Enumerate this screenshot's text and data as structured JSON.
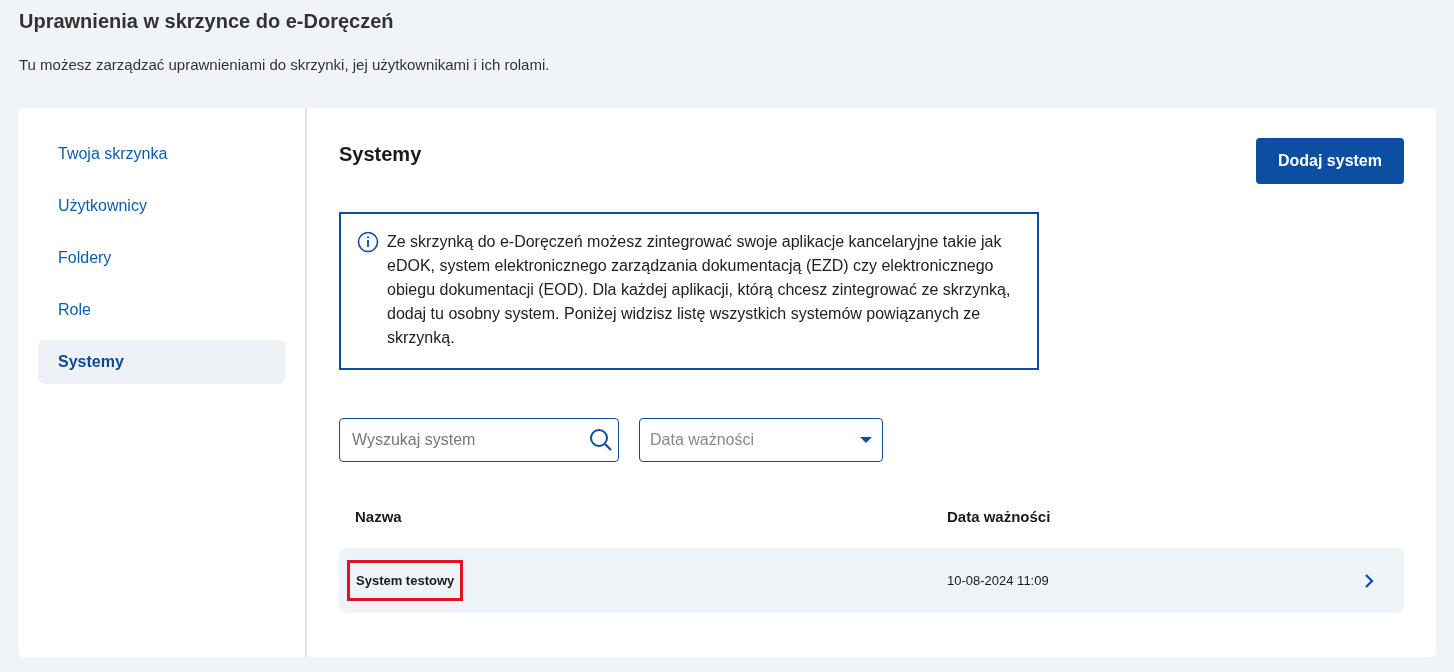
{
  "page": {
    "title": "Uprawnienia w skrzynce do e-Doręczeń",
    "description": "Tu możesz zarządzać uprawnieniami do skrzynki, jej użytkownikami i ich rolami."
  },
  "sidebar": {
    "items": [
      {
        "label": "Twoja skrzynka",
        "selected": false
      },
      {
        "label": "Użytkownicy",
        "selected": false
      },
      {
        "label": "Foldery",
        "selected": false
      },
      {
        "label": "Role",
        "selected": false
      },
      {
        "label": "Systemy",
        "selected": true
      }
    ]
  },
  "content": {
    "title": "Systemy",
    "add_button": "Dodaj system",
    "info": "Ze skrzynką do e-Doręczeń możesz zintegrować swoje aplikacje kancelaryjne takie jak eDOK, system elektronicznego zarządzania dokumentacją (EZD) czy elektronicznego obiegu dokumentacji (EOD). Dla każdej aplikacji, którą chcesz zintegrować ze skrzynką, dodaj tu osobny system. Poniżej widzisz listę wszystkich systemów powiązanych ze skrzynką.",
    "search": {
      "placeholder": "Wyszukaj system"
    },
    "filter": {
      "placeholder": "Data ważności"
    },
    "table": {
      "columns": [
        "Nazwa",
        "Data ważności"
      ],
      "rows": [
        {
          "name": "System testowy",
          "date": "10-08-2024 11:09",
          "highlighted": true
        }
      ]
    }
  }
}
